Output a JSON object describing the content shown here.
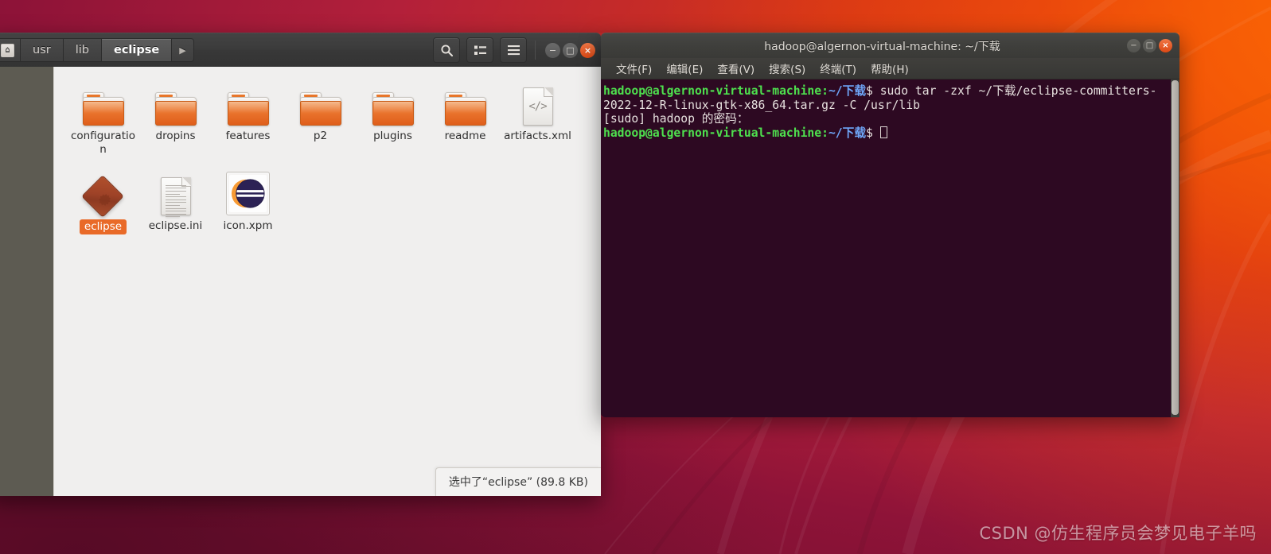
{
  "desktop": {
    "wallpaper_colors": {
      "orange": "#ef520f",
      "red": "#c22232",
      "crimson": "#8e1338",
      "maroon": "#7d1230"
    },
    "watermark": "CSDN @仿生程序员会梦见电子羊吗"
  },
  "file_manager": {
    "breadcrumb": {
      "home_icon": "home-icon",
      "items": [
        {
          "label": "usr",
          "active": false
        },
        {
          "label": "lib",
          "active": false
        },
        {
          "label": "eclipse",
          "active": true
        }
      ],
      "next_arrow": "▶"
    },
    "toolbar": {
      "search_icon": "search-icon",
      "view_list_icon": "list-view-icon",
      "menu_icon": "hamburger-menu-icon"
    },
    "window_controls": {
      "minimize": "−",
      "maximize": "□",
      "close": "×"
    },
    "files": [
      {
        "name": "configuration",
        "type": "folder",
        "selected": false
      },
      {
        "name": "dropins",
        "type": "folder",
        "selected": false
      },
      {
        "name": "features",
        "type": "folder",
        "selected": false
      },
      {
        "name": "p2",
        "type": "folder",
        "selected": false
      },
      {
        "name": "plugins",
        "type": "folder",
        "selected": false
      },
      {
        "name": "readme",
        "type": "folder",
        "selected": false
      },
      {
        "name": "artifacts.xml",
        "type": "xml-document",
        "selected": false
      },
      {
        "name": "eclipse",
        "type": "executable",
        "selected": true
      },
      {
        "name": "eclipse.ini",
        "type": "text-document",
        "selected": false
      },
      {
        "name": "icon.xpm",
        "type": "image",
        "selected": false,
        "framed": true
      }
    ],
    "status_bar": "选中了“eclipse” (89.8 KB)"
  },
  "terminal": {
    "title": "hadoop@algernon-virtual-machine: ~/下载",
    "menus": [
      {
        "label": "文件(F)"
      },
      {
        "label": "编辑(E)"
      },
      {
        "label": "查看(V)"
      },
      {
        "label": "搜索(S)"
      },
      {
        "label": "终端(T)"
      },
      {
        "label": "帮助(H)"
      }
    ],
    "window_controls": {
      "minimize": "−",
      "maximize": "□",
      "close": "×"
    },
    "lines": [
      {
        "prompt_user": "hadoop@algernon-virtual-machine",
        "prompt_sep": ":",
        "prompt_path": "~/下载",
        "prompt_tail": "$ ",
        "command": "sudo tar -zxf ~/下载/eclipse-committers-"
      },
      {
        "text": "2022-12-R-linux-gtk-x86_64.tar.gz -C /usr/lib"
      },
      {
        "text": "[sudo] hadoop 的密码："
      },
      {
        "prompt_user": "hadoop@algernon-virtual-machine",
        "prompt_sep": ":",
        "prompt_path": "~/下载",
        "prompt_tail": "$ ",
        "command": ""
      }
    ],
    "colors": {
      "background": "#2d0922",
      "user": "#4ee04e",
      "path": "#6ea5f7",
      "text": "#e8e2e0"
    }
  }
}
